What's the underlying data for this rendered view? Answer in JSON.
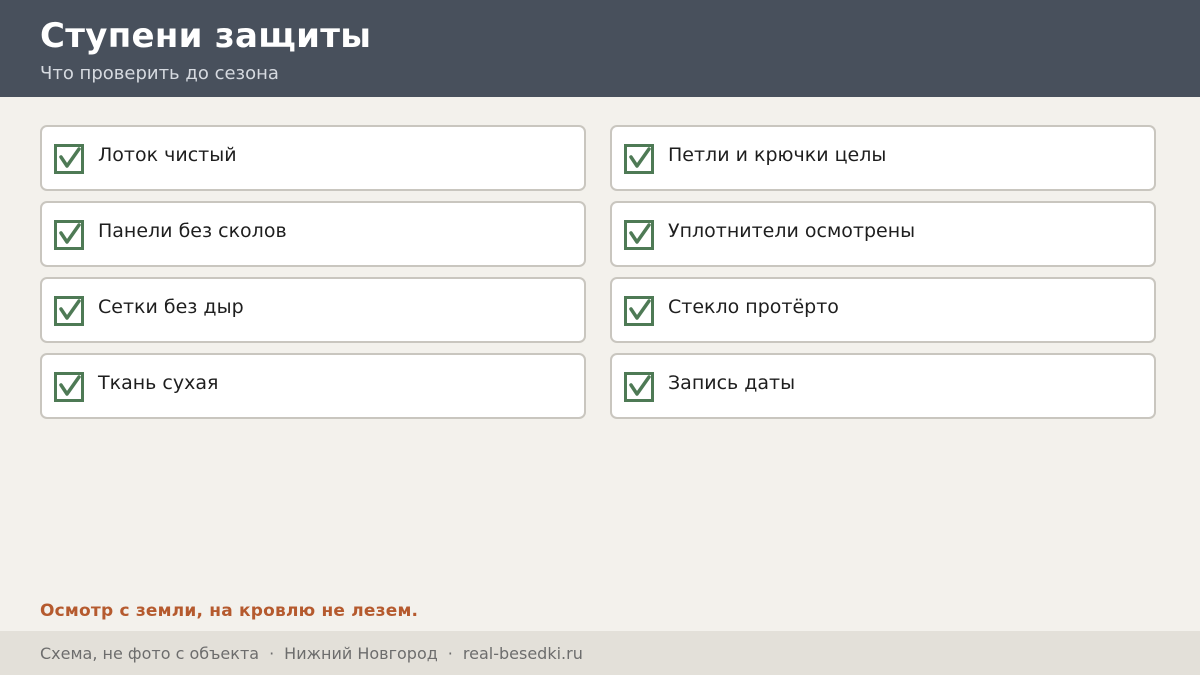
{
  "header": {
    "title": "Ступени защиты",
    "subtitle": "Что проверить до сезона"
  },
  "checklist": {
    "left": [
      {
        "label": "Лоток чистый",
        "checked": true
      },
      {
        "label": "Панели без сколов",
        "checked": true
      },
      {
        "label": "Сетки без дыр",
        "checked": true
      },
      {
        "label": "Ткань сухая",
        "checked": true
      }
    ],
    "right": [
      {
        "label": "Петли и крючки целы",
        "checked": true
      },
      {
        "label": "Уплотнители осмотрены",
        "checked": true
      },
      {
        "label": "Стекло протёрто",
        "checked": true
      },
      {
        "label": "Запись даты",
        "checked": true
      }
    ]
  },
  "note": "Осмотр с земли, на кровлю не лезем.",
  "footer": {
    "caption": "Схема, не фото с объекта",
    "separator": "·",
    "city": "Нижний Новгород",
    "site": "real-besedki.ru"
  },
  "colors": {
    "header_bg": "#48505c",
    "check_green": "#4e7a55",
    "accent_note": "#b55a2e"
  },
  "icons": {
    "check": "checkbox-checked-icon"
  }
}
